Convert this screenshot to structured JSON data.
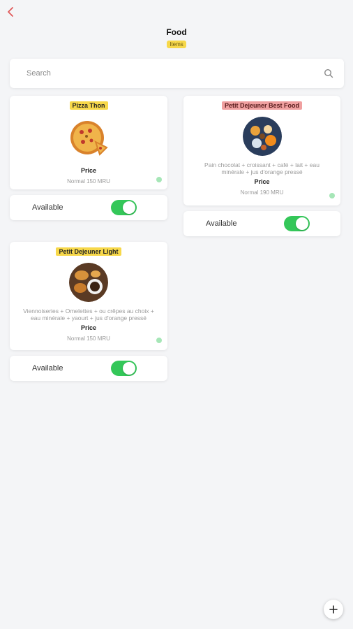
{
  "header": {
    "title": "Food",
    "tag": "Items"
  },
  "search": {
    "placeholder": "Search",
    "value": ""
  },
  "items": [
    {
      "name": "Pizza Thon",
      "description": "",
      "price_label": "Price",
      "price": "Normal 150 MRU",
      "availability_label": "Available",
      "available": true
    },
    {
      "name": "Petit Dejeuner Best Food",
      "description": "Pain chocolat + croissant + café + lait + eau minérale + jus d'orange pressé",
      "price_label": "Price",
      "price": "Normal 190 MRU",
      "availability_label": "Available",
      "available": true
    },
    {
      "name": "Petit Dejeuner Light",
      "description": "Viennoiseries + Omelettes + ou crêpes au choix + eau minérale + yaourt + jus d'orange pressé",
      "price_label": "Price",
      "price": "Normal 150 MRU",
      "availability_label": "Available",
      "available": true
    }
  ],
  "icons": {
    "back": "chevron-left-icon",
    "search": "search-icon",
    "add": "plus-icon"
  },
  "colors": {
    "accent_yellow": "#f7d84a",
    "accent_pink": "#f0a0a0",
    "toggle_on": "#34c759",
    "back_red": "#e05a5a"
  }
}
